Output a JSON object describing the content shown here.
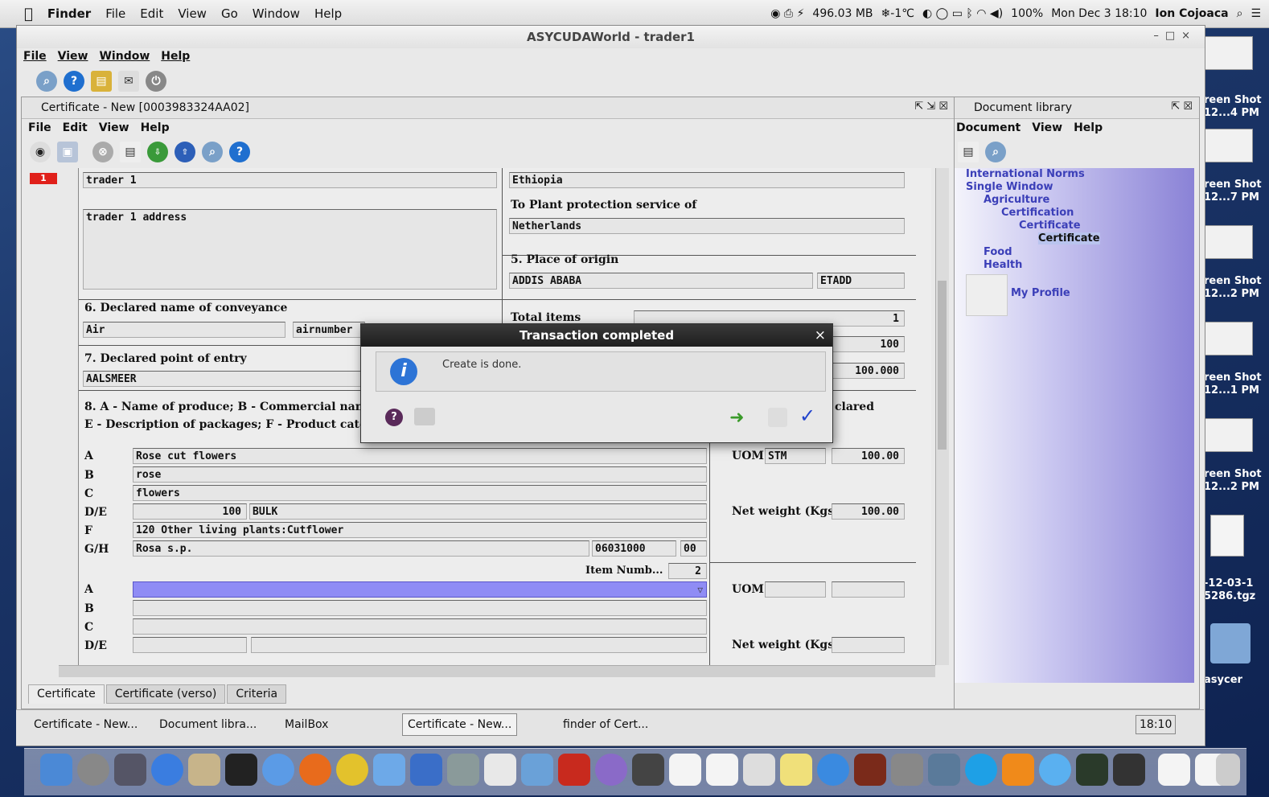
{
  "mac_menubar": {
    "app": "Finder",
    "items": [
      "File",
      "Edit",
      "View",
      "Go",
      "Window",
      "Help"
    ],
    "memory": "496.03 MB",
    "temperature": "❄-1℃",
    "battery": "100%",
    "clock": "Mon Dec 3  18:10",
    "user": "Ion Cojoaca"
  },
  "window": {
    "title": "ASYCUDAWorld - trader1",
    "menu": [
      "File",
      "View",
      "Window",
      "Help"
    ]
  },
  "certificate": {
    "title": "Certificate - New [0003983324AA02]",
    "menu": [
      "File",
      "Edit",
      "View",
      "Help"
    ],
    "row_marker": "1",
    "consignor_name": "trader 1",
    "consignor_address": "trader 1 address",
    "country_from": "Ethiopia",
    "to_plant_label": "To Plant protection service of",
    "to_plant_value": "Netherlands",
    "place_origin_label": "5. Place of origin",
    "place_origin_value": "ADDIS ABABA",
    "place_origin_code": "ETADD",
    "conveyance_label": "6. Declared name of conveyance",
    "conveyance_value": "Air",
    "conveyance_number": "airnumber",
    "total_items_label": "Total items",
    "total_items_value": "1",
    "total_qty_value": "100",
    "total_weight_value": "100.000",
    "entry_label": "7. Declared point of entry",
    "entry_value": "AALSMEER",
    "produce_label_1": "8. A - Name of produce; B - Commercial name;",
    "produce_label_2": "E - Description of packages; F - Product catego",
    "declared_fragment": "clared",
    "item1": {
      "A": "Rose cut flowers",
      "B": "rose",
      "C": "flowers",
      "D_qty": "100",
      "D_pkg": "BULK",
      "F": "120 Other living plants:Cutflower",
      "G": "Rosa s.p.",
      "hs": "06031000",
      "hs2": "00",
      "uom_label": "UOM",
      "uom": "STM",
      "uom_value": "100.00",
      "net_label": "Net weight (Kgs)",
      "net_value": "100.00"
    },
    "item_number_label": "Item Numb...",
    "item_number_value": "2",
    "row_labels": [
      "A",
      "B",
      "C",
      "D/E",
      "F",
      "G/H"
    ],
    "item2": {
      "uom_label": "UOM",
      "net_label": "Net weight (Kgs)"
    },
    "tabs": [
      "Certificate",
      "Certificate (verso)",
      "Criteria"
    ]
  },
  "doclib": {
    "title": "Document library",
    "menu": [
      "Document",
      "View",
      "Help"
    ],
    "tree": [
      "International Norms",
      "Single Window",
      "Agriculture",
      "Certification",
      "Certificate",
      "Certificate",
      "Food",
      "Health"
    ],
    "profile": "My Profile"
  },
  "dialog": {
    "title": "Transaction completed",
    "message": "Create is done.",
    "close": "×"
  },
  "taskbar": {
    "items": [
      "Certificate - New...",
      "Document libra...",
      "MailBox",
      "Certificate - New...",
      "finder of Cert..."
    ],
    "clock": "18:10"
  },
  "desktop_labels": [
    "reen Shot",
    "12...4 PM",
    "reen Shot",
    "12...7 PM",
    "reen Shot",
    "12...2 PM",
    "reen Shot",
    "12...1 PM",
    "reen Shot",
    "12...2 PM",
    "-12-03-1",
    "5286.tgz",
    "asycer"
  ]
}
